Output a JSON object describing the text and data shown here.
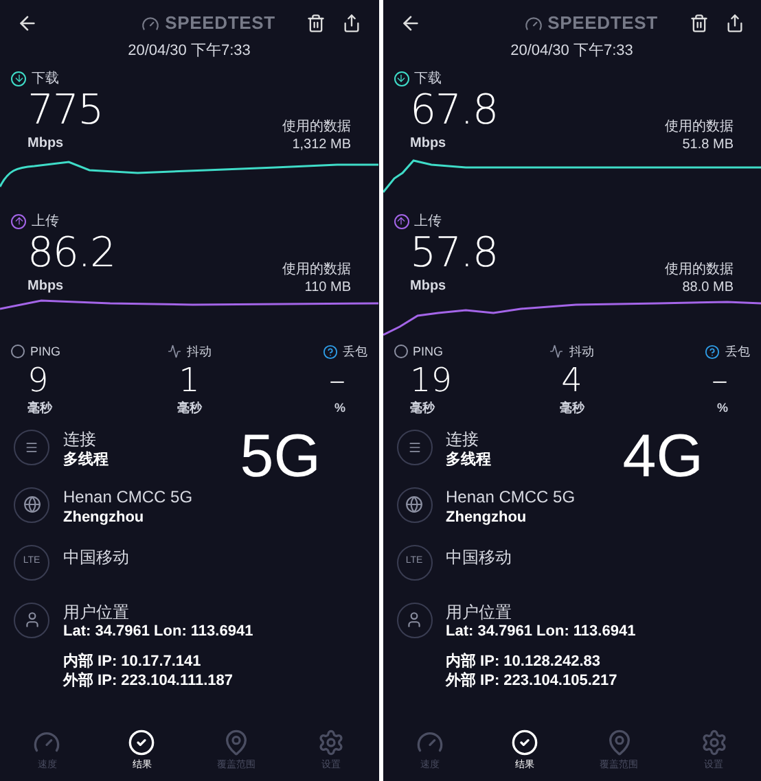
{
  "panels": [
    {
      "brand": "SPEEDTEST",
      "datetime": "20/04/30 下午7:33",
      "download": {
        "label": "下载",
        "value": "775",
        "unit": "Mbps",
        "data_label": "使用的数据",
        "data_value": "1,312 MB"
      },
      "upload": {
        "label": "上传",
        "value": "86.2",
        "unit": "Mbps",
        "data_label": "使用的数据",
        "data_value": "110 MB"
      },
      "metrics": [
        {
          "label": "PING",
          "value": "9",
          "unit": "毫秒"
        },
        {
          "label": "抖动",
          "value": "1",
          "unit": "毫秒"
        },
        {
          "label": "丢包",
          "value": "–",
          "unit": "%"
        }
      ],
      "connection": {
        "title": "连接",
        "value": "多线程"
      },
      "network_badge": "5G",
      "server": {
        "name": "Henan CMCC 5G",
        "city": "Zhengzhou"
      },
      "carrier": {
        "badge": "LTE",
        "name": "中国移动"
      },
      "location": {
        "title": "用户位置",
        "coords": "Lat: 34.7961 Lon: 113.6941",
        "internal_ip": "内部 IP: 10.17.7.141",
        "external_ip": "外部 IP: 223.104.111.187"
      },
      "nav": [
        {
          "label": "速度",
          "selected": false
        },
        {
          "label": "结果",
          "selected": true
        },
        {
          "label": "覆盖范围",
          "selected": false
        },
        {
          "label": "设置",
          "selected": false
        }
      ]
    },
    {
      "brand": "SPEEDTEST",
      "datetime": "20/04/30 下午7:33",
      "download": {
        "label": "下载",
        "value": "67.8",
        "unit": "Mbps",
        "data_label": "使用的数据",
        "data_value": "51.8 MB"
      },
      "upload": {
        "label": "上传",
        "value": "57.8",
        "unit": "Mbps",
        "data_label": "使用的数据",
        "data_value": "88.0 MB"
      },
      "metrics": [
        {
          "label": "PING",
          "value": "19",
          "unit": "毫秒"
        },
        {
          "label": "抖动",
          "value": "4",
          "unit": "毫秒"
        },
        {
          "label": "丢包",
          "value": "–",
          "unit": "%"
        }
      ],
      "connection": {
        "title": "连接",
        "value": "多线程"
      },
      "network_badge": "4G",
      "server": {
        "name": "Henan CMCC 5G",
        "city": "Zhengzhou"
      },
      "carrier": {
        "badge": "LTE",
        "name": "中国移动"
      },
      "location": {
        "title": "用户位置",
        "coords": "Lat: 34.7961 Lon: 113.6941",
        "internal_ip": "内部 IP: 10.128.242.83",
        "external_ip": "外部 IP: 223.104.105.217"
      },
      "nav": [
        {
          "label": "速度",
          "selected": false
        },
        {
          "label": "结果",
          "selected": true
        },
        {
          "label": "覆盖范围",
          "selected": false
        },
        {
          "label": "设置",
          "selected": false
        }
      ]
    }
  ]
}
